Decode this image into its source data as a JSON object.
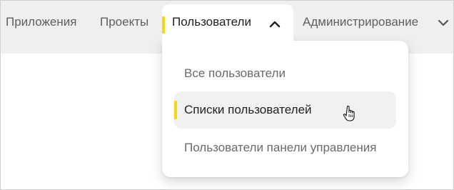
{
  "nav": {
    "items": [
      {
        "label": "Приложения"
      },
      {
        "label": "Проекты"
      },
      {
        "label": "Пользователи",
        "state": "active",
        "expanded": true
      },
      {
        "label": "Администрирование"
      }
    ],
    "chevron_up_icon": "chevron-up-icon",
    "chevron_down_icon": "chevron-down-icon"
  },
  "dropdown": {
    "items": [
      {
        "label": "Все пользователи"
      },
      {
        "label": "Списки пользователей",
        "state": "hovered"
      },
      {
        "label": "Пользователи панели управления"
      }
    ]
  },
  "cursor_icon": "hand-pointer-icon",
  "colors": {
    "accent": "#f7d51d",
    "navbar_bg": "#efefef",
    "hover_bg": "#f1f1f1",
    "text_muted": "#6a6a6a",
    "text_active": "#222222"
  }
}
